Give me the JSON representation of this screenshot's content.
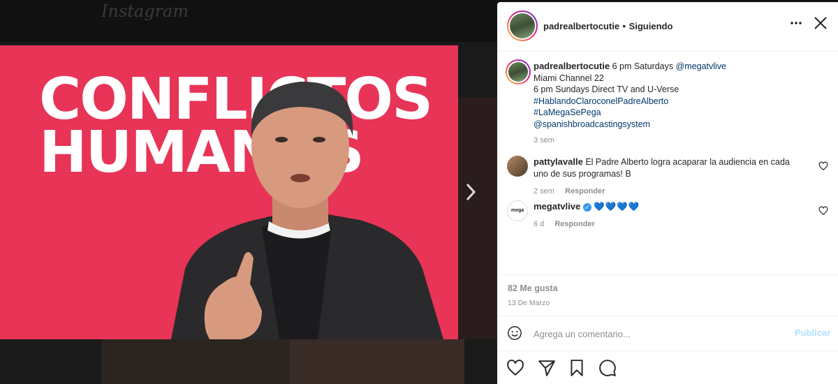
{
  "app": {
    "logo": "Instagram"
  },
  "media": {
    "title_line1": "CONFLICTOS",
    "title_line2": "HUMANOS",
    "next_icon": "chevron-right-icon"
  },
  "header": {
    "username": "padrealbertocutie",
    "separator": "•",
    "follow_status": "Siguiendo",
    "more_icon": "more-horizontal-icon",
    "close_icon": "close-icon"
  },
  "caption": {
    "username": "padrealbertocutie",
    "line1": "6 pm Saturdays ",
    "mention1": "@megatvlive",
    "line2": "Miami Channel 22",
    "line3": "6 pm Sundays Direct TV and U-Verse",
    "hashtag1": "#HablandoClaroconelPadreAlberto",
    "hashtag2": "#LaMegaSePega",
    "mention2": "@spanishbroadcastingsystem",
    "time": "3 sem"
  },
  "comments": [
    {
      "username": "pattylavalle",
      "text": "El Padre Alberto logra acaparar la audiencia en cada uno de sus programas! B",
      "time": "2 sem",
      "reply": "Responder"
    },
    {
      "username": "megatvlive",
      "avatar_text": "mega",
      "text": "💙💙💙💙",
      "time": "6 d",
      "reply": "Responder"
    }
  ],
  "stats": {
    "likes": "82 Me gusta",
    "date": "13 De Marzo"
  },
  "comment_box": {
    "placeholder": "Agrega un comentario...",
    "publish": "Publicar"
  },
  "colors": {
    "media_bg": "#e83457",
    "link": "#00376b",
    "verified": "#3897f0"
  }
}
